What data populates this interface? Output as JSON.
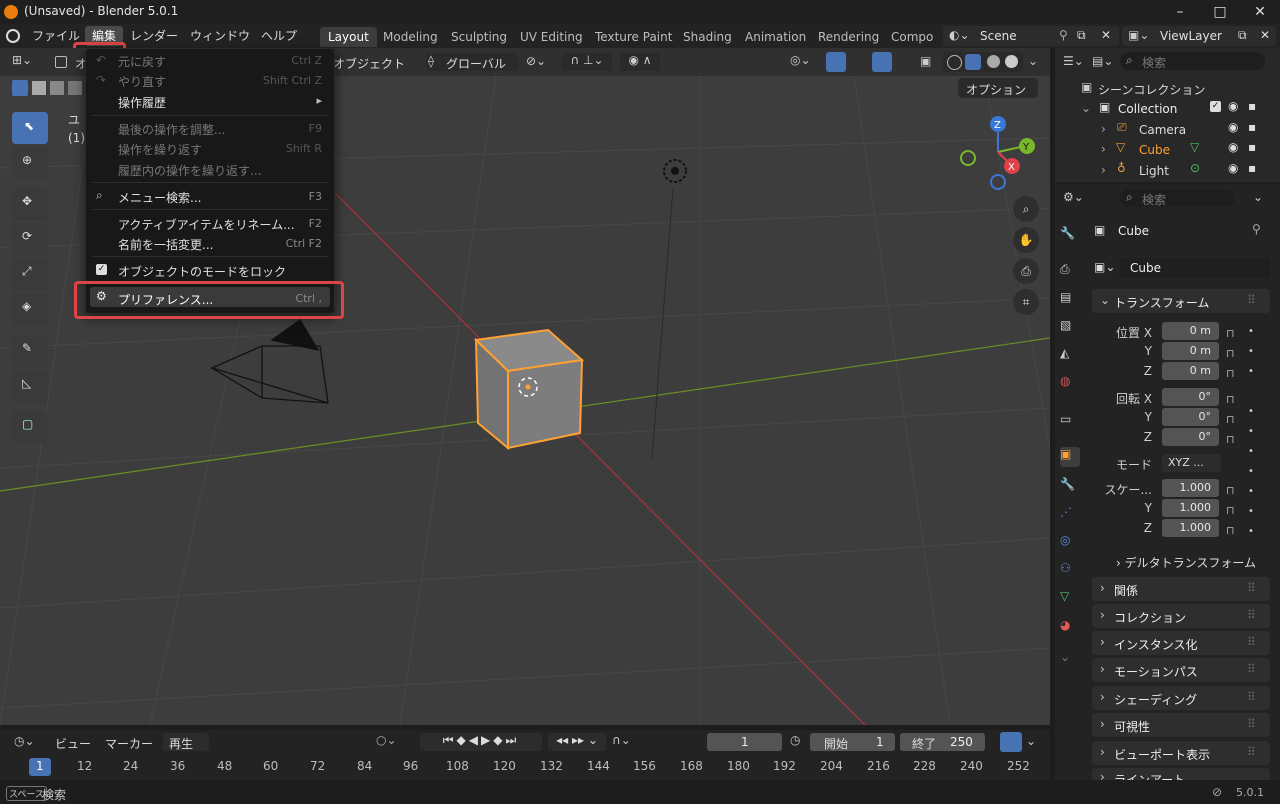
{
  "window": {
    "title": "(Unsaved) - Blender 5.0.1",
    "min": "–",
    "max": "□",
    "close": "✕"
  },
  "menubar": {
    "items": [
      "ファイル",
      "編集",
      "レンダー",
      "ウィンドウ",
      "ヘルプ"
    ],
    "workspaces": [
      "Layout",
      "Modeling",
      "Sculpting",
      "UV Editing",
      "Texture Paint",
      "Shading",
      "Animation",
      "Rendering",
      "Compo"
    ],
    "scene": "Scene",
    "viewlayer": "ViewLayer"
  },
  "viewport_header": {
    "mode_label": "オ",
    "object_label": "オブジェクト",
    "transform": "グローバル",
    "options": "オプション"
  },
  "viewport_overlay": {
    "line1": "ユ",
    "line2": "(1)"
  },
  "edit_menu": {
    "items": [
      {
        "label": "元に戻す",
        "shortcut": "Ctrl Z",
        "disabled": true
      },
      {
        "label": "やり直す",
        "shortcut": "Shift Ctrl Z",
        "disabled": true
      },
      {
        "label": "操作履歴",
        "shortcut": "▸",
        "disabled": false
      },
      {
        "label": "最後の操作を調整...",
        "shortcut": "F9",
        "disabled": true
      },
      {
        "label": "操作を繰り返す",
        "shortcut": "Shift R",
        "disabled": true
      },
      {
        "label": "履歴内の操作を繰り返す...",
        "shortcut": "",
        "disabled": true
      },
      {
        "label": "メニュー検索...",
        "shortcut": "F3",
        "disabled": false
      },
      {
        "label": "アクティブアイテムをリネーム...",
        "shortcut": "F2",
        "disabled": false
      },
      {
        "label": "名前を一括変更...",
        "shortcut": "Ctrl F2",
        "disabled": false
      },
      {
        "label": "オブジェクトのモードをロック",
        "shortcut": "",
        "disabled": false
      },
      {
        "label": "プリファレンス...",
        "shortcut": "Ctrl ,",
        "disabled": false
      }
    ]
  },
  "outliner": {
    "search_placeholder": "検索",
    "scene_collection": "シーンコレクション",
    "collection": "Collection",
    "objects": [
      "Camera",
      "Cube",
      "Light"
    ]
  },
  "properties": {
    "search_placeholder": "検索",
    "object_name": "Cube",
    "data_name": "Cube",
    "transform_title": "トランスフォーム",
    "location_label": "位置 X",
    "loc": [
      "0 m",
      "0 m",
      "0 m"
    ],
    "rotation_label": "回転 X",
    "rot": [
      "0°",
      "0°",
      "0°"
    ],
    "mode_label": "モード",
    "mode_value": "XYZ ...",
    "scale_label": "スケー...",
    "scale": [
      "1.000",
      "1.000",
      "1.000"
    ],
    "axis_y": "Y",
    "axis_z": "Z",
    "delta": "デルタトランスフォーム",
    "panels": [
      "関係",
      "コレクション",
      "インスタンス化",
      "モーションパス",
      "シェーディング",
      "可視性",
      "ビューポート表示",
      "ラインアート"
    ]
  },
  "timeline": {
    "view": "ビュー",
    "marker": "マーカー",
    "playback": "再生",
    "current_frame": "1",
    "start_label": "開始",
    "start": "1",
    "end_label": "終了",
    "end": "250",
    "frames": [
      "1",
      "12",
      "24",
      "36",
      "48",
      "60",
      "72",
      "84",
      "96",
      "108",
      "120",
      "132",
      "144",
      "156",
      "168",
      "180",
      "192",
      "204",
      "216",
      "228",
      "240",
      "252"
    ]
  },
  "statusbar": {
    "key": "スペース",
    "action": "検索",
    "version": "5.0.1"
  },
  "colors": {
    "accent": "#4772b3",
    "highlight": "#e04545",
    "selected": "#ffa033"
  }
}
